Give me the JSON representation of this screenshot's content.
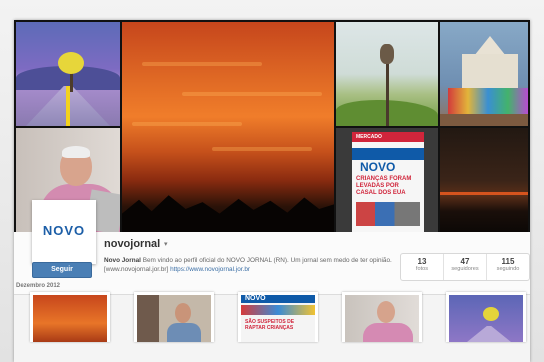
{
  "profile": {
    "avatar_text": "NOVO",
    "follow_label": "Seguir",
    "username": "novojornal",
    "caret": "▾",
    "bio_name": "Novo Jornal",
    "bio_text": " Bem vindo ao perfil oficial do NOVO JORNAL (RN). Um jornal sem medo de ter opinião. [www.novojornal.jor.br] ",
    "bio_link": "https://www.novojornal.jor.br"
  },
  "stats": [
    {
      "value": "13",
      "label": "fotos"
    },
    {
      "value": "47",
      "label": "seguidores"
    },
    {
      "value": "115",
      "label": "seguindo"
    }
  ],
  "grid": {
    "month_label": "Dezembro 2012"
  },
  "newspaper": {
    "tagline": "MERCADO",
    "masthead": "NOVO",
    "headline": "CRIANÇAS FORAM LEVADAS POR CASAL DOS EUA"
  },
  "thumb_newspaper": {
    "masthead": "NOVO",
    "headline": "SÃO SUSPEITOS DE RAPTAR CRIANÇAS"
  }
}
